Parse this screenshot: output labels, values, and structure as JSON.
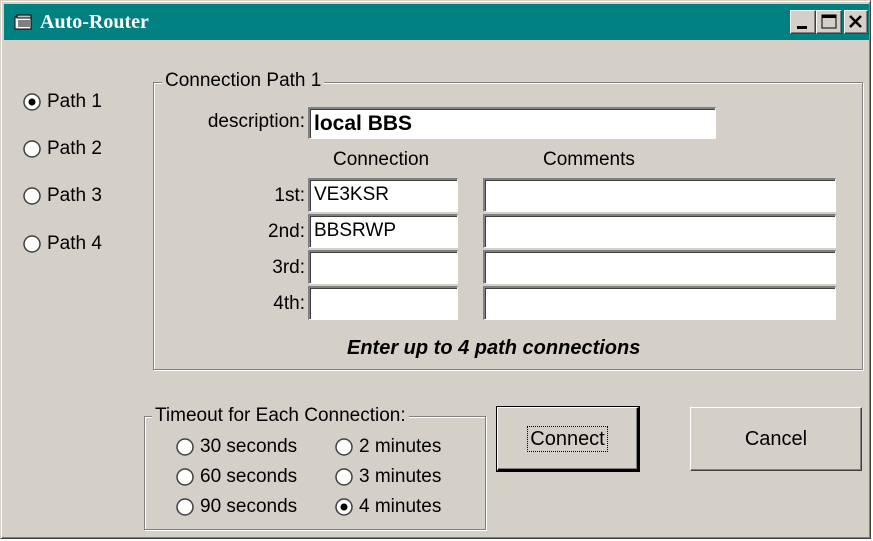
{
  "window": {
    "title": "Auto-Router",
    "icons": {
      "app": "folder-icon",
      "minimize": "minimize-icon",
      "maximize": "maximize-icon",
      "close": "close-icon"
    }
  },
  "paths": {
    "options": [
      "Path 1",
      "Path 2",
      "Path 3",
      "Path 4"
    ],
    "selected_index": 0
  },
  "connection_group": {
    "legend": "Connection Path 1",
    "description_label": "description:",
    "description_value": "local BBS",
    "connection_header": "Connection",
    "comments_header": "Comments",
    "rows": [
      {
        "label": "1st:",
        "connection": "VE3KSR",
        "comment": ""
      },
      {
        "label": "2nd:",
        "connection": "BBSRWP",
        "comment": ""
      },
      {
        "label": "3rd:",
        "connection": "",
        "comment": ""
      },
      {
        "label": "4th:",
        "connection": "",
        "comment": ""
      }
    ],
    "hint": "Enter up to 4 path connections"
  },
  "timeout_group": {
    "legend": "Timeout for Each Connection:",
    "options": [
      "30 seconds",
      "2 minutes",
      "60 seconds",
      "3 minutes",
      "90 seconds",
      "4 minutes"
    ],
    "selected": "4 minutes"
  },
  "buttons": {
    "connect": "Connect",
    "cancel": "Cancel"
  },
  "colors": {
    "titlebar": "#008080",
    "face": "#d4d0c8"
  }
}
